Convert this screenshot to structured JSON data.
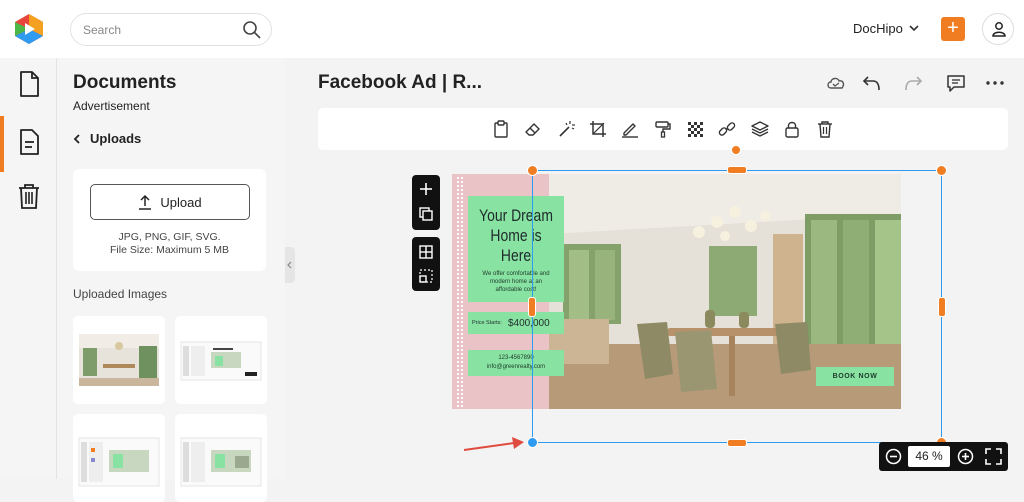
{
  "app": {
    "account_label": "DocHipo"
  },
  "search": {
    "placeholder": "Search"
  },
  "panel": {
    "title": "Documents",
    "subtitle": "Advertisement",
    "back_label": "Uploads",
    "upload_button": "Upload",
    "upload_hint_formats": "JPG, PNG, GIF, SVG.",
    "upload_hint_size": "File Size: Maximum 5 MB",
    "uploaded_images_label": "Uploaded Images"
  },
  "editor": {
    "document_title": "Facebook Ad | R...",
    "zoom_value": "46",
    "zoom_unit": "%"
  },
  "ad": {
    "headline": "Your Dream Home is Here",
    "description": "We offer comfortable and modern home at an affordable cost!",
    "price_label": "Price Starts:",
    "price_value": "$400,000",
    "phone": "123-4567890",
    "email": "info@greenrealty.com",
    "cta": "BOOK NOW"
  },
  "colors": {
    "accent": "#f07d22",
    "selection": "#2e9bf0",
    "ad_green": "#88e3a3",
    "ad_pink": "#e9c3c6"
  }
}
